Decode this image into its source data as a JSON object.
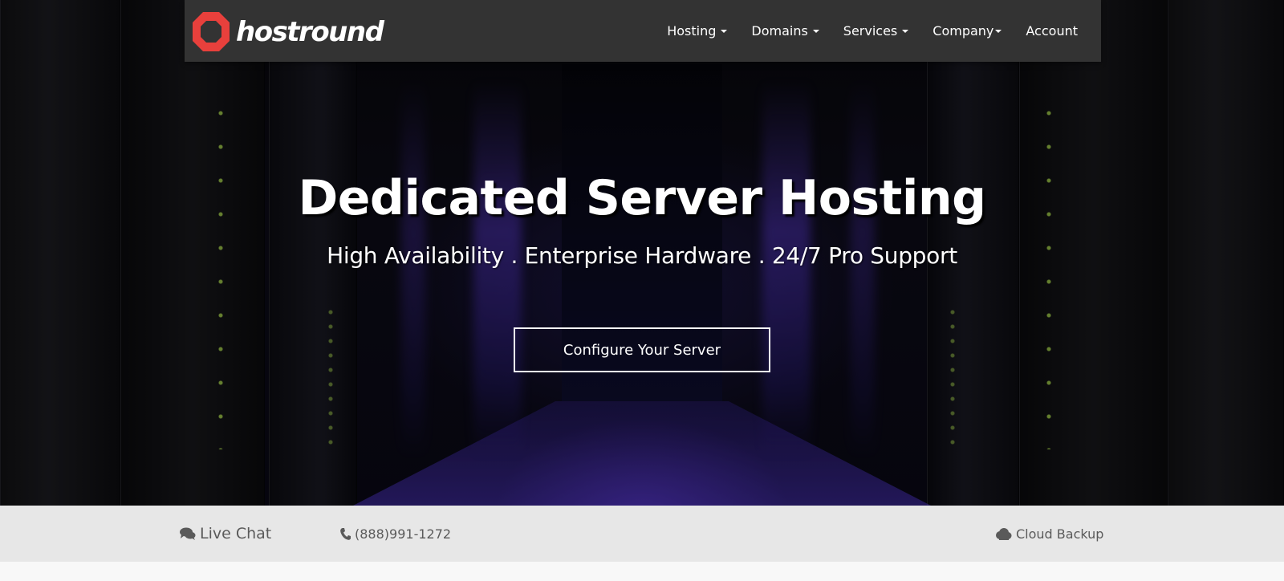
{
  "header": {
    "brand_name": "hostround",
    "nav": [
      {
        "label": "Hosting"
      },
      {
        "label": "Domains"
      },
      {
        "label": "Services"
      },
      {
        "label": "Company"
      },
      {
        "label": "Account"
      }
    ]
  },
  "hero": {
    "title": "Dedicated Server Hosting",
    "subtitle": "High Availability . Enterprise Hardware . 24/7 Pro Support",
    "cta_label": "Configure Your Server"
  },
  "infobar": {
    "live_chat": "Live Chat",
    "phone": "(888)991-1272",
    "cloud_backup": "Cloud Backup"
  },
  "colors": {
    "header_bg": "#333333",
    "brand_red": "#e8403c",
    "infobar_bg": "#e7e7e7",
    "infobar_text": "#5a5a5a"
  },
  "icons": {
    "logo": "octagon-ring-logo",
    "chat": "chat-bubbles-icon",
    "phone": "phone-icon",
    "cloud": "cloud-icon",
    "dropdown": "caret-down-icon"
  }
}
